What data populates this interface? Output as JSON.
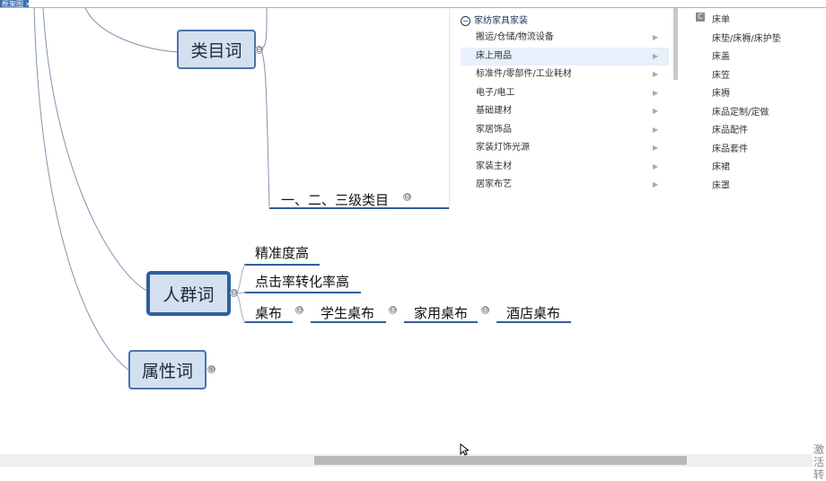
{
  "tab": {
    "label": "框架图",
    "close": "×"
  },
  "nodes": {
    "category_word": "类目词",
    "crowd_word": "人群词",
    "attribute_word": "属性词"
  },
  "leaves": {
    "levels": "一、二、三级类目",
    "precision": "精准度高",
    "conversion": "点击率转化率高",
    "tablecloth": "桌布",
    "student_tablecloth": "学生桌布",
    "home_tablecloth": "家用桌布",
    "hotel_tablecloth": "酒店桌布"
  },
  "toggles": {
    "collapse": "⊖",
    "expand": "⊕"
  },
  "category_panel": {
    "header": "家纺家具家装",
    "header_badge": "C",
    "items": [
      {
        "label": "搬运/仓储/物流设备"
      },
      {
        "label": "床上用品"
      },
      {
        "label": "标准件/零部件/工业耗材"
      },
      {
        "label": "电子/电工"
      },
      {
        "label": "基础建材"
      },
      {
        "label": "家居饰品"
      },
      {
        "label": "家装灯饰光源"
      },
      {
        "label": "家装主材"
      },
      {
        "label": "居家布艺"
      }
    ],
    "active_index": 1,
    "arrow": "▶",
    "sub_badge": "C",
    "sub_items": [
      "床单",
      "床垫/床褥/床护垫",
      "床盖",
      "床笠",
      "床褥",
      "床品定制/定做",
      "床品配件",
      "床品套件",
      "床裙",
      "床罩"
    ]
  },
  "corner_text": "激活转"
}
